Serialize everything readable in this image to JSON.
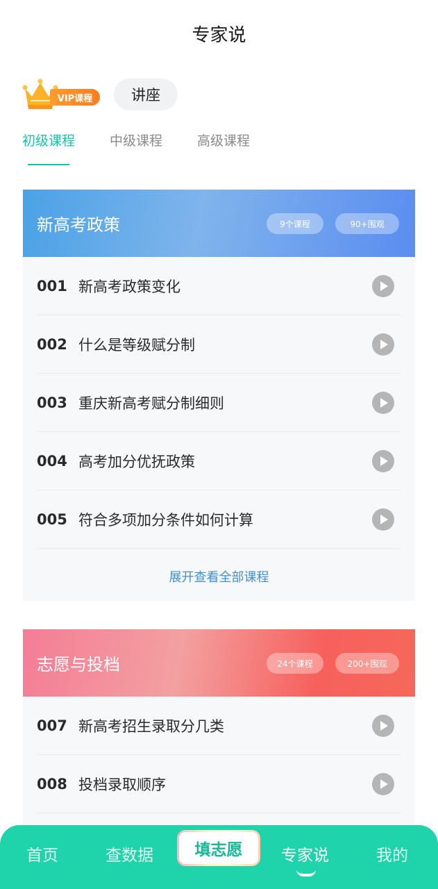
{
  "header": {
    "title": "专家说"
  },
  "type_row": {
    "vip_label": "VIP课程",
    "lecture_label": "讲座"
  },
  "level_tabs": [
    "初级课程",
    "中级课程",
    "高级课程"
  ],
  "colors": {
    "accent": "#17c3a8",
    "link": "#3f8fd4",
    "tabbar": "#1fd3ab"
  },
  "cards": [
    {
      "title": "新高考政策",
      "count_label": "9个课程",
      "views_label": "90+围观",
      "lessons": [
        {
          "num": "001",
          "name": "新高考政策变化"
        },
        {
          "num": "002",
          "name": "什么是等级赋分制"
        },
        {
          "num": "003",
          "name": "重庆新高考赋分制细则"
        },
        {
          "num": "004",
          "name": "高考加分优抚政策"
        },
        {
          "num": "005",
          "name": "符合多项加分条件如何计算"
        }
      ],
      "expand_label": "展开查看全部课程"
    },
    {
      "title": "志愿与投档",
      "count_label": "24个课程",
      "views_label": "200+围观",
      "lessons": [
        {
          "num": "007",
          "name": "新高考招生录取分几类"
        },
        {
          "num": "008",
          "name": "投档录取顺序"
        }
      ]
    }
  ],
  "tabbar": {
    "home": "首页",
    "data": "查数据",
    "fill": "填志愿",
    "expert": "专家说",
    "mine": "我的"
  }
}
